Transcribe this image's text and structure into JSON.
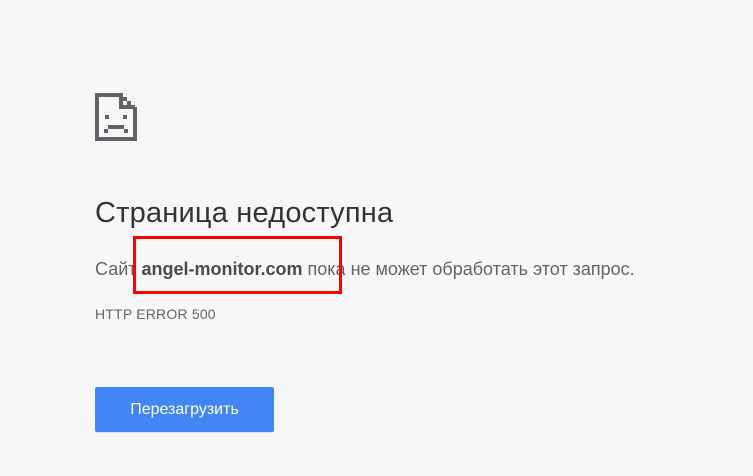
{
  "error": {
    "icon": "sad-page-icon",
    "title": "Страница недоступна",
    "message_prefix": "Сайт ",
    "host": "angel-monitor.com",
    "message_suffix": " пока не может обработать этот запрос.",
    "code": "HTTP ERROR 500"
  },
  "actions": {
    "reload_label": "Перезагрузить"
  },
  "colors": {
    "background": "#f7f7f7",
    "button": "#4285f4",
    "highlight": "#ff0000"
  }
}
